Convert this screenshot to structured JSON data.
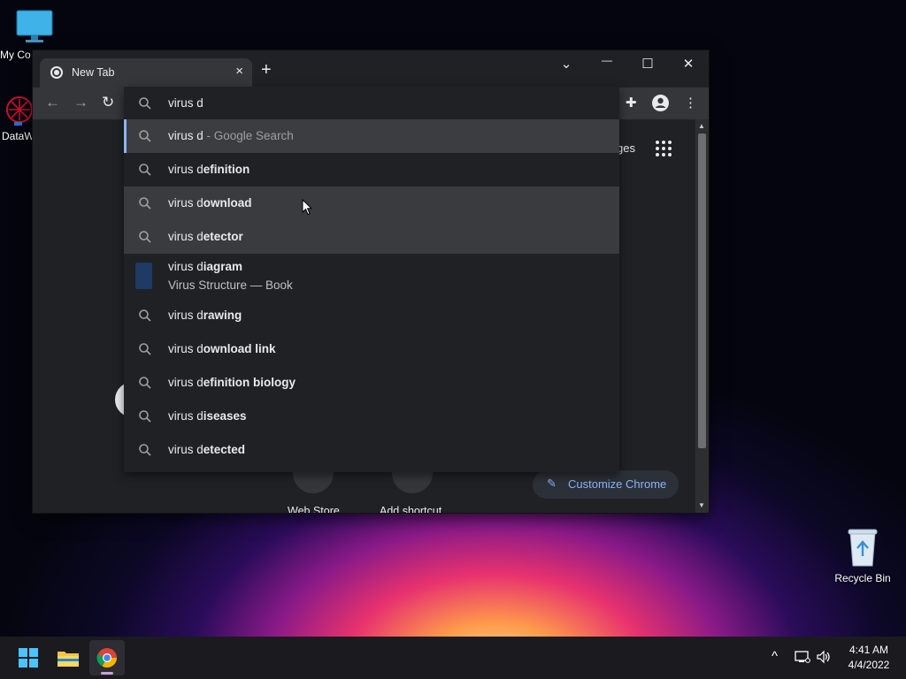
{
  "desktop": {
    "icons": [
      {
        "name": "my-computer-icon",
        "label": "My Co"
      },
      {
        "name": "datawrapper-icon",
        "label": "DataW"
      },
      {
        "name": "recycle-bin-icon",
        "label": "Recycle Bin"
      }
    ]
  },
  "browser": {
    "tab_title": "New Tab",
    "tab_close": "×",
    "new_tab": "+",
    "window_controls": {
      "dropdown": "⌄",
      "minimize": "—",
      "maximize": "☐",
      "close": "✕"
    },
    "nav": {
      "back": "←",
      "forward": "→",
      "reload": "↻"
    },
    "toolbar_right": {
      "extensions": "✚",
      "more": "⋮"
    },
    "ntp": {
      "images_link": "ges",
      "shortcuts": [
        {
          "label": "Web Store"
        },
        {
          "label": "Add shortcut"
        }
      ],
      "customize_label": "Customize Chrome",
      "customize_icon": "✎"
    }
  },
  "omnibox": {
    "query": "virus d",
    "suggestions": [
      {
        "type": "search",
        "prefix": "virus d",
        "bold": "",
        "suffix": " - Google Search",
        "state": "selected"
      },
      {
        "type": "search",
        "prefix": "virus d",
        "bold": "efinition"
      },
      {
        "type": "search",
        "prefix": "virus d",
        "bold": "ownload",
        "state": "hover"
      },
      {
        "type": "search",
        "prefix": "virus d",
        "bold": "etector",
        "state": "hover2"
      },
      {
        "type": "entity",
        "prefix": "virus d",
        "bold": "iagram",
        "subtitle": "Virus Structure — Book"
      },
      {
        "type": "search",
        "prefix": "virus d",
        "bold": "rawing"
      },
      {
        "type": "search",
        "prefix": "virus d",
        "bold": "ownload link"
      },
      {
        "type": "search",
        "prefix": "virus d",
        "bold": "efinition biology"
      },
      {
        "type": "search",
        "prefix": "virus d",
        "bold": "iseases"
      },
      {
        "type": "search",
        "prefix": "virus d",
        "bold": "etected"
      }
    ]
  },
  "taskbar": {
    "apps": [
      {
        "name": "start-button"
      },
      {
        "name": "file-explorer-icon"
      },
      {
        "name": "chrome-taskbar-icon",
        "active": true
      }
    ],
    "tray": {
      "chevron": "^",
      "time": "4:41 AM",
      "date": "4/4/2022"
    }
  },
  "colors": {
    "accent": "#8ab4f8",
    "window_bg": "#202124",
    "toolbar_bg": "#35363a"
  }
}
